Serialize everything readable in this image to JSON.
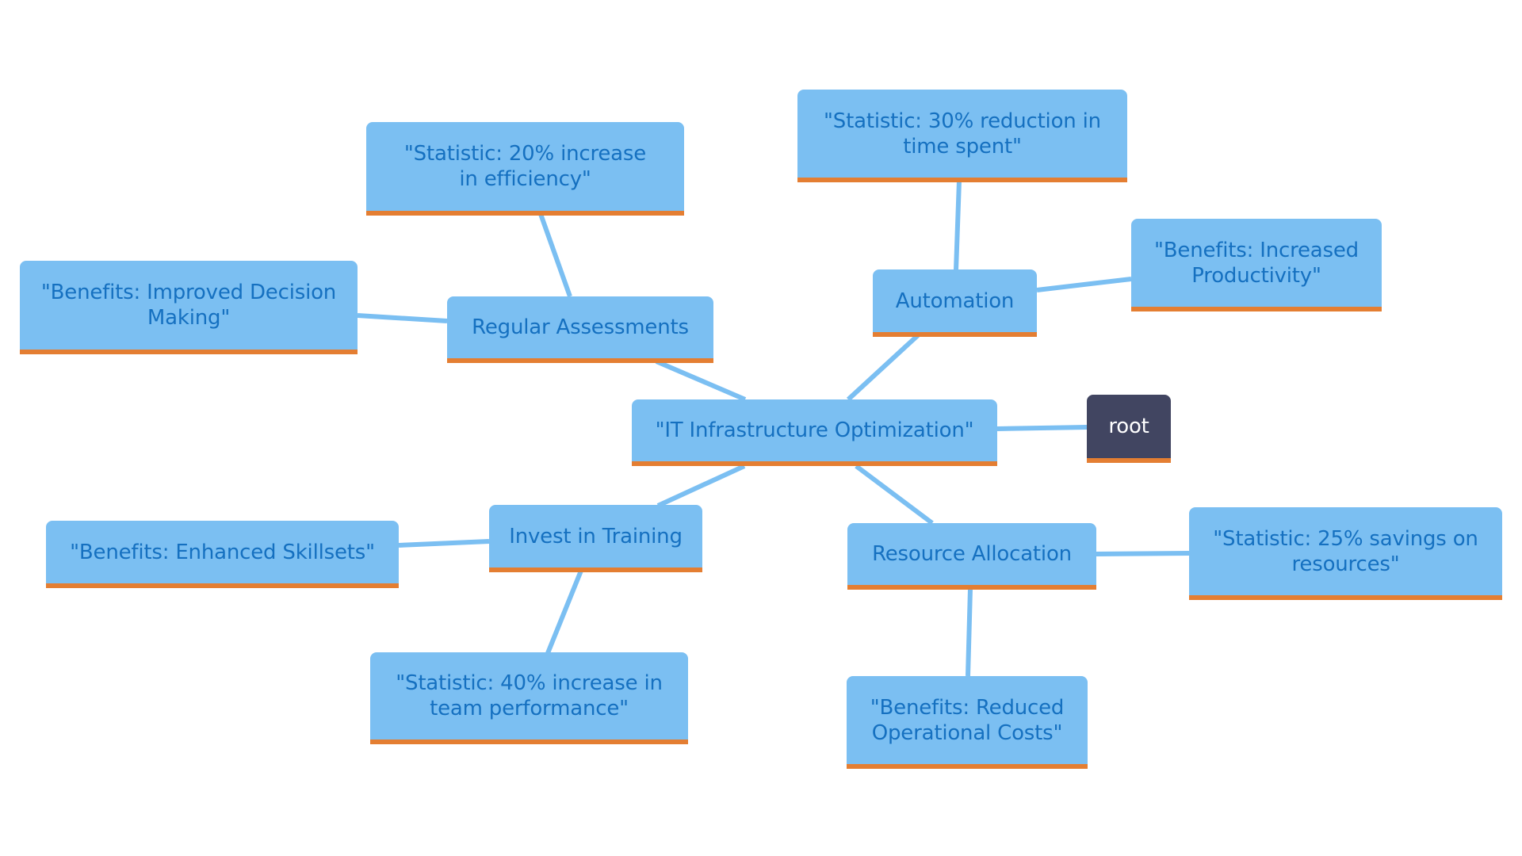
{
  "diagram": {
    "type": "mindmap",
    "colors": {
      "node_fill": "#7bbff2",
      "node_text": "#1570c0",
      "node_underline": "#e47e32",
      "edge": "#7bbff2",
      "root_fill": "#414561",
      "root_text": "#ffffff"
    },
    "nodes": [
      {
        "id": "root",
        "label": "root"
      },
      {
        "id": "center",
        "label": "\"IT Infrastructure Optimization\""
      },
      {
        "id": "regular",
        "label": "Regular Assessments"
      },
      {
        "id": "stat20",
        "label": "\"Statistic: 20% increase in efficiency\""
      },
      {
        "id": "benefit_decision",
        "label": "\"Benefits: Improved Decision Making\""
      },
      {
        "id": "automation",
        "label": "Automation"
      },
      {
        "id": "stat30",
        "label": "\"Statistic: 30% reduction in time spent\""
      },
      {
        "id": "benefit_productivity",
        "label": "\"Benefits: Increased Productivity\""
      },
      {
        "id": "training",
        "label": "Invest in Training"
      },
      {
        "id": "benefit_skillsets",
        "label": "\"Benefits: Enhanced Skillsets\""
      },
      {
        "id": "stat40",
        "label": "\"Statistic: 40% increase in team performance\""
      },
      {
        "id": "resource",
        "label": "Resource Allocation"
      },
      {
        "id": "stat25",
        "label": "\"Statistic: 25% savings on resources\""
      },
      {
        "id": "benefit_costs",
        "label": "\"Benefits: Reduced Operational Costs\""
      }
    ],
    "edges": [
      [
        "center",
        "root"
      ],
      [
        "center",
        "regular"
      ],
      [
        "center",
        "automation"
      ],
      [
        "center",
        "training"
      ],
      [
        "center",
        "resource"
      ],
      [
        "regular",
        "stat20"
      ],
      [
        "regular",
        "benefit_decision"
      ],
      [
        "automation",
        "stat30"
      ],
      [
        "automation",
        "benefit_productivity"
      ],
      [
        "training",
        "benefit_skillsets"
      ],
      [
        "training",
        "stat40"
      ],
      [
        "resource",
        "stat25"
      ],
      [
        "resource",
        "benefit_costs"
      ]
    ]
  }
}
